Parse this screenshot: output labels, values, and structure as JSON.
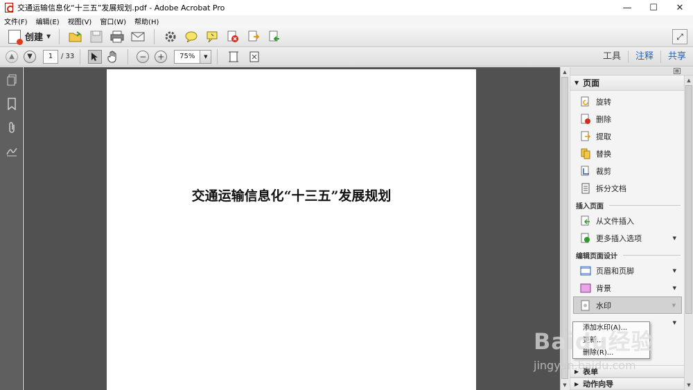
{
  "window": {
    "title": "交通运输信息化“十三五”发展规划.pdf - Adobe Acrobat Pro",
    "minimize": "—",
    "maximize": "☐",
    "close": "✕"
  },
  "menubar": {
    "items": [
      "文件(F)",
      "编辑(E)",
      "视图(V)",
      "窗口(W)",
      "帮助(H)"
    ]
  },
  "toolbar1": {
    "create_label": "创建",
    "icons": [
      "open-folder-icon",
      "save-icon",
      "print-icon",
      "email-icon",
      "gear-icon",
      "comment-icon",
      "highlight-icon",
      "delete-page-icon",
      "extract-icon",
      "insert-icon"
    ],
    "expand_icon": "expand-icon"
  },
  "toolbar2": {
    "current_page": "1",
    "total_pages": "/ 33",
    "zoom": "75%",
    "tabs": [
      "工具",
      "注释",
      "共享"
    ]
  },
  "document": {
    "title": "交通运输信息化“十三五”发展规划"
  },
  "right_panel": {
    "section_pages": "页面",
    "page_items": [
      {
        "label": "旋转",
        "icon": "rotate-icon"
      },
      {
        "label": "删除",
        "icon": "delete-icon"
      },
      {
        "label": "提取",
        "icon": "extract-icon"
      },
      {
        "label": "替换",
        "icon": "replace-icon"
      },
      {
        "label": "裁剪",
        "icon": "crop-icon"
      },
      {
        "label": "拆分文档",
        "icon": "split-icon"
      }
    ],
    "insert_heading": "插入页面",
    "insert_items": [
      {
        "label": "从文件插入",
        "icon": "insert-file-icon"
      },
      {
        "label": "更多插入选项",
        "icon": "more-insert-icon"
      }
    ],
    "design_heading": "编辑页面设计",
    "design_items": [
      {
        "label": "页眉和页脚",
        "icon": "header-footer-icon"
      },
      {
        "label": "背景",
        "icon": "background-icon"
      },
      {
        "label": "水印",
        "icon": "watermark-icon"
      }
    ],
    "bottom_section_partial": "表单",
    "bottom_section": "动作向导"
  },
  "popup_menu": {
    "items": [
      "添加水印(A)...",
      "更新...",
      "删除(R)..."
    ]
  },
  "watermark": {
    "logo": "Baidu经验",
    "url": "jingyan.baidu.com"
  }
}
